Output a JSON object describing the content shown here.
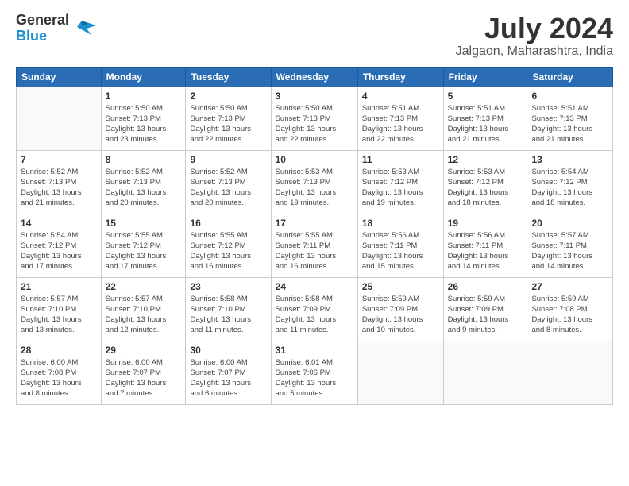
{
  "header": {
    "logo_general": "General",
    "logo_blue": "Blue",
    "month": "July 2024",
    "location": "Jalgaon, Maharashtra, India"
  },
  "days_of_week": [
    "Sunday",
    "Monday",
    "Tuesday",
    "Wednesday",
    "Thursday",
    "Friday",
    "Saturday"
  ],
  "weeks": [
    [
      {
        "day": "",
        "info": ""
      },
      {
        "day": "1",
        "info": "Sunrise: 5:50 AM\nSunset: 7:13 PM\nDaylight: 13 hours\nand 23 minutes."
      },
      {
        "day": "2",
        "info": "Sunrise: 5:50 AM\nSunset: 7:13 PM\nDaylight: 13 hours\nand 22 minutes."
      },
      {
        "day": "3",
        "info": "Sunrise: 5:50 AM\nSunset: 7:13 PM\nDaylight: 13 hours\nand 22 minutes."
      },
      {
        "day": "4",
        "info": "Sunrise: 5:51 AM\nSunset: 7:13 PM\nDaylight: 13 hours\nand 22 minutes."
      },
      {
        "day": "5",
        "info": "Sunrise: 5:51 AM\nSunset: 7:13 PM\nDaylight: 13 hours\nand 21 minutes."
      },
      {
        "day": "6",
        "info": "Sunrise: 5:51 AM\nSunset: 7:13 PM\nDaylight: 13 hours\nand 21 minutes."
      }
    ],
    [
      {
        "day": "7",
        "info": "Sunrise: 5:52 AM\nSunset: 7:13 PM\nDaylight: 13 hours\nand 21 minutes."
      },
      {
        "day": "8",
        "info": "Sunrise: 5:52 AM\nSunset: 7:13 PM\nDaylight: 13 hours\nand 20 minutes."
      },
      {
        "day": "9",
        "info": "Sunrise: 5:52 AM\nSunset: 7:13 PM\nDaylight: 13 hours\nand 20 minutes."
      },
      {
        "day": "10",
        "info": "Sunrise: 5:53 AM\nSunset: 7:13 PM\nDaylight: 13 hours\nand 19 minutes."
      },
      {
        "day": "11",
        "info": "Sunrise: 5:53 AM\nSunset: 7:12 PM\nDaylight: 13 hours\nand 19 minutes."
      },
      {
        "day": "12",
        "info": "Sunrise: 5:53 AM\nSunset: 7:12 PM\nDaylight: 13 hours\nand 18 minutes."
      },
      {
        "day": "13",
        "info": "Sunrise: 5:54 AM\nSunset: 7:12 PM\nDaylight: 13 hours\nand 18 minutes."
      }
    ],
    [
      {
        "day": "14",
        "info": "Sunrise: 5:54 AM\nSunset: 7:12 PM\nDaylight: 13 hours\nand 17 minutes."
      },
      {
        "day": "15",
        "info": "Sunrise: 5:55 AM\nSunset: 7:12 PM\nDaylight: 13 hours\nand 17 minutes."
      },
      {
        "day": "16",
        "info": "Sunrise: 5:55 AM\nSunset: 7:12 PM\nDaylight: 13 hours\nand 16 minutes."
      },
      {
        "day": "17",
        "info": "Sunrise: 5:55 AM\nSunset: 7:11 PM\nDaylight: 13 hours\nand 16 minutes."
      },
      {
        "day": "18",
        "info": "Sunrise: 5:56 AM\nSunset: 7:11 PM\nDaylight: 13 hours\nand 15 minutes."
      },
      {
        "day": "19",
        "info": "Sunrise: 5:56 AM\nSunset: 7:11 PM\nDaylight: 13 hours\nand 14 minutes."
      },
      {
        "day": "20",
        "info": "Sunrise: 5:57 AM\nSunset: 7:11 PM\nDaylight: 13 hours\nand 14 minutes."
      }
    ],
    [
      {
        "day": "21",
        "info": "Sunrise: 5:57 AM\nSunset: 7:10 PM\nDaylight: 13 hours\nand 13 minutes."
      },
      {
        "day": "22",
        "info": "Sunrise: 5:57 AM\nSunset: 7:10 PM\nDaylight: 13 hours\nand 12 minutes."
      },
      {
        "day": "23",
        "info": "Sunrise: 5:58 AM\nSunset: 7:10 PM\nDaylight: 13 hours\nand 11 minutes."
      },
      {
        "day": "24",
        "info": "Sunrise: 5:58 AM\nSunset: 7:09 PM\nDaylight: 13 hours\nand 11 minutes."
      },
      {
        "day": "25",
        "info": "Sunrise: 5:59 AM\nSunset: 7:09 PM\nDaylight: 13 hours\nand 10 minutes."
      },
      {
        "day": "26",
        "info": "Sunrise: 5:59 AM\nSunset: 7:09 PM\nDaylight: 13 hours\nand 9 minutes."
      },
      {
        "day": "27",
        "info": "Sunrise: 5:59 AM\nSunset: 7:08 PM\nDaylight: 13 hours\nand 8 minutes."
      }
    ],
    [
      {
        "day": "28",
        "info": "Sunrise: 6:00 AM\nSunset: 7:08 PM\nDaylight: 13 hours\nand 8 minutes."
      },
      {
        "day": "29",
        "info": "Sunrise: 6:00 AM\nSunset: 7:07 PM\nDaylight: 13 hours\nand 7 minutes."
      },
      {
        "day": "30",
        "info": "Sunrise: 6:00 AM\nSunset: 7:07 PM\nDaylight: 13 hours\nand 6 minutes."
      },
      {
        "day": "31",
        "info": "Sunrise: 6:01 AM\nSunset: 7:06 PM\nDaylight: 13 hours\nand 5 minutes."
      },
      {
        "day": "",
        "info": ""
      },
      {
        "day": "",
        "info": ""
      },
      {
        "day": "",
        "info": ""
      }
    ]
  ]
}
